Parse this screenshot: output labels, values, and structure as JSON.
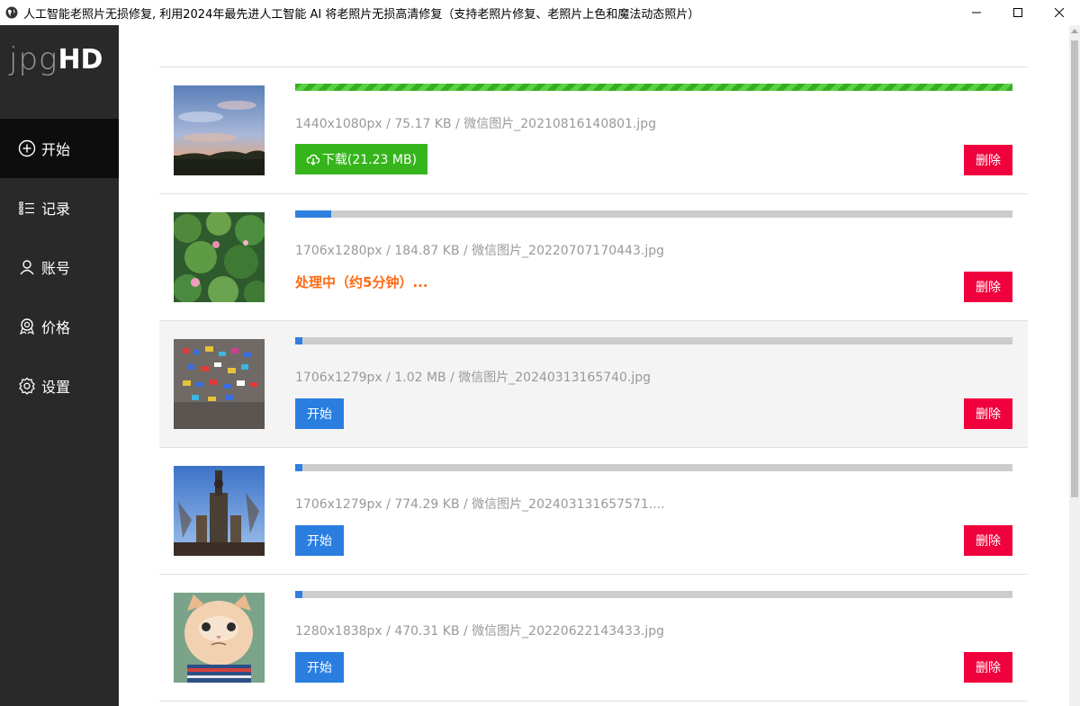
{
  "window": {
    "title": "人工智能老照片无损修复, 利用2024年最先进人工智能 AI 将老照片无损高清修复（支持老照片修复、老照片上色和魔法动态照片）"
  },
  "logo": {
    "thin": "jpg",
    "bold": "HD"
  },
  "sidebar": {
    "items": [
      {
        "label": "开始",
        "icon": "plus-circle-icon",
        "active": true
      },
      {
        "label": "记录",
        "icon": "list-icon"
      },
      {
        "label": "账号",
        "icon": "user-icon"
      },
      {
        "label": "价格",
        "icon": "badge-icon"
      },
      {
        "label": "设置",
        "icon": "gear-icon"
      }
    ]
  },
  "items": [
    {
      "info": "1440x1080px / 75.17 KB / 微信图片_20210816140801.jpg",
      "progress": 1.0,
      "progress_color": "green",
      "action": "下载(21.23 MB)",
      "action_type": "download",
      "delete": "删除",
      "thumb": "sky-photo"
    },
    {
      "info": "1706x1280px / 184.87 KB / 微信图片_20220707170443.jpg",
      "progress": 0.05,
      "progress_color": "blue",
      "status": "处理中（约5分钟）...",
      "delete": "删除",
      "thumb": "lotus-photo"
    },
    {
      "info": "1706x1279px / 1.02 MB / 微信图片_20240313165740.jpg",
      "progress": 0.01,
      "progress_color": "blue",
      "action": "开始",
      "action_type": "start",
      "delete": "删除",
      "thumb": "wall-photo",
      "highlighted": true
    },
    {
      "info": "1706x1279px / 774.29 KB / 微信图片_202403131657571....",
      "progress": 0.01,
      "progress_color": "blue",
      "action": "开始",
      "action_type": "start",
      "delete": "删除",
      "thumb": "tower-photo"
    },
    {
      "info": "1280x1838px / 470.31 KB / 微信图片_20220622143433.jpg",
      "progress": 0.01,
      "progress_color": "blue",
      "action": "开始",
      "action_type": "start",
      "delete": "删除",
      "thumb": "cat-photo"
    }
  ],
  "colors": {
    "sidebar_bg": "#292929",
    "download": "#35b51b",
    "start": "#2a7ee0",
    "delete": "#f0003c",
    "status": "#ff6a13",
    "progress_bg": "#cccccc"
  }
}
